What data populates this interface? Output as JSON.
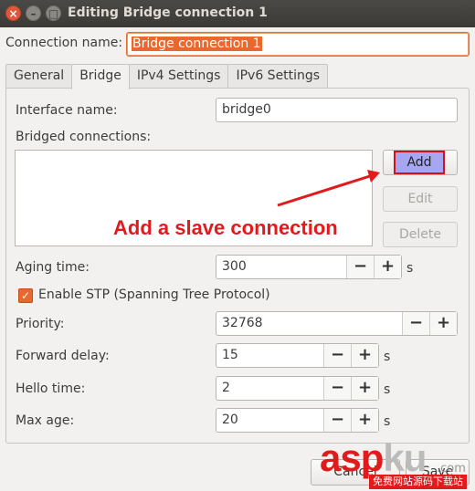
{
  "window": {
    "title": "Editing Bridge connection 1",
    "close_glyph": "×",
    "min_glyph": "–",
    "max_glyph": "□"
  },
  "connection": {
    "label": "Connection name:",
    "value": "Bridge connection 1"
  },
  "tabs": [
    {
      "label": "General",
      "active": false
    },
    {
      "label": "Bridge",
      "active": true
    },
    {
      "label": "IPv4 Settings",
      "active": false
    },
    {
      "label": "IPv6 Settings",
      "active": false
    }
  ],
  "bridge": {
    "interface_label": "Interface name:",
    "interface_value": "bridge0",
    "bridged_label": "Bridged connections:",
    "buttons": {
      "add": "Add",
      "edit": "Edit",
      "delete": "Delete"
    },
    "annotation": "Add a slave connection",
    "aging_label": "Aging time:",
    "aging_value": "300",
    "aging_unit": "s",
    "stp_label": "Enable STP (Spanning Tree Protocol)",
    "stp_checked": true,
    "priority_label": "Priority:",
    "priority_value": "32768",
    "forward_label": "Forward delay:",
    "forward_value": "15",
    "forward_unit": "s",
    "hello_label": "Hello time:",
    "hello_value": "2",
    "hello_unit": "s",
    "maxage_label": "Max age:",
    "maxage_value": "20",
    "maxage_unit": "s",
    "minus": "−",
    "plus": "+"
  },
  "footer": {
    "cancel": "Cancel",
    "save": "Save"
  },
  "watermark": {
    "asp": "asp",
    "ku": "ku",
    "sub": "免费网站源码下载站",
    "com": ".com"
  },
  "colors": {
    "accent": "#e9682d",
    "annotation": "#e31a1c"
  }
}
